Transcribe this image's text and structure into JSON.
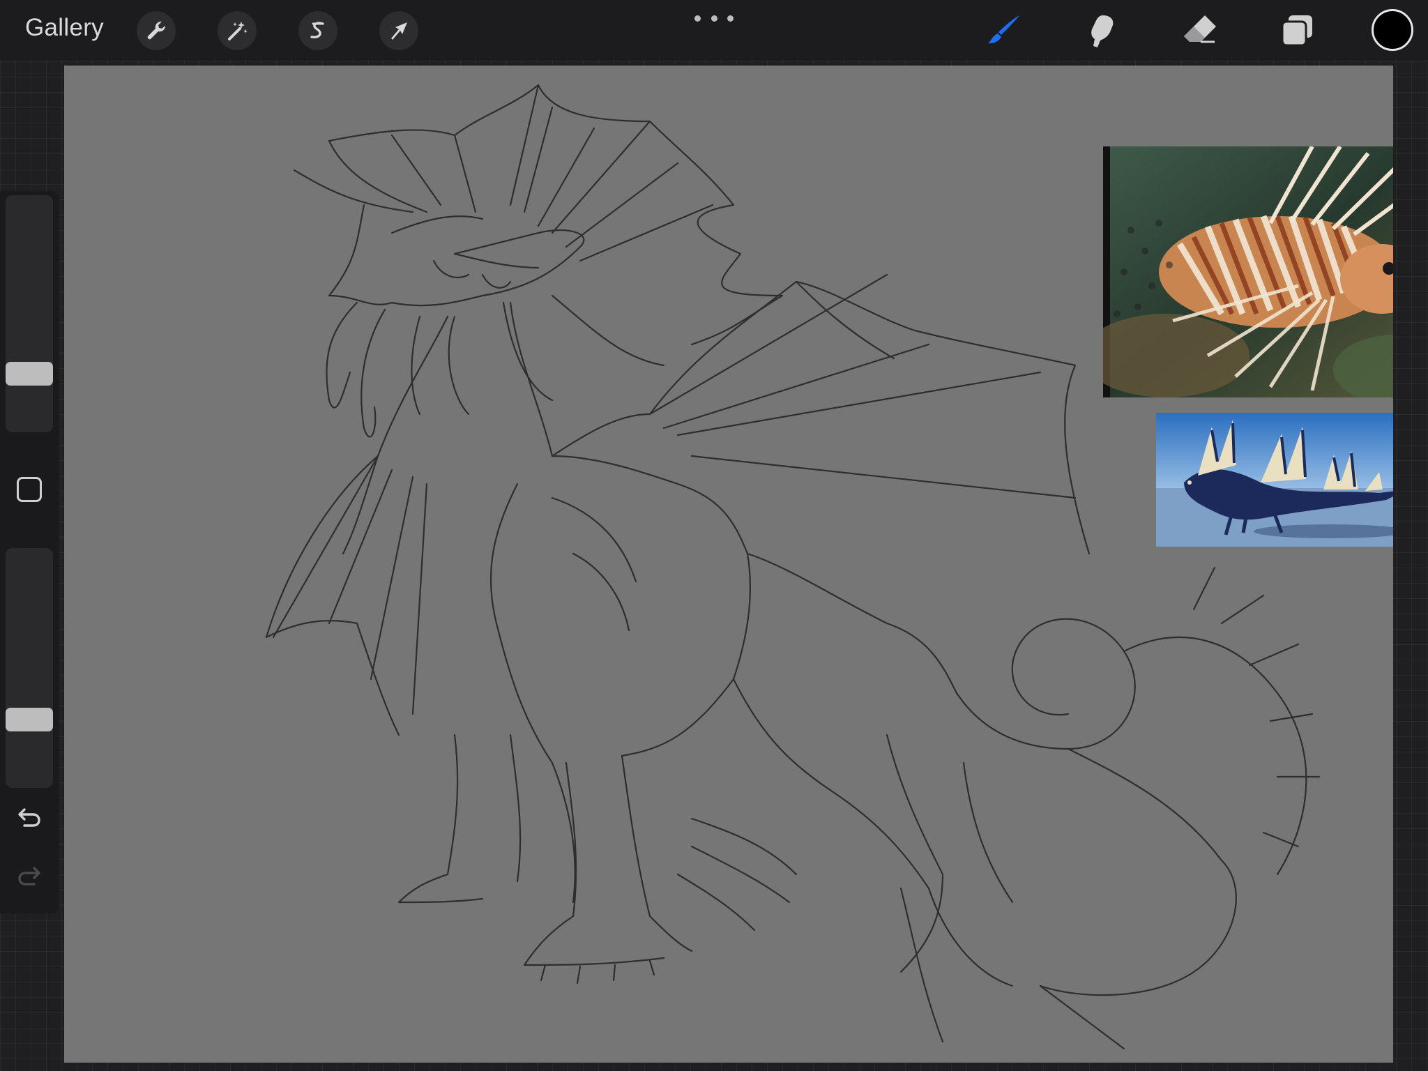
{
  "app": {
    "gallery_label": "Gallery"
  },
  "toolbar_left": [
    {
      "name": "actions",
      "icon": "wrench-icon"
    },
    {
      "name": "adjustments",
      "icon": "magic-wand-icon"
    },
    {
      "name": "selection",
      "icon": "selection-s-icon"
    },
    {
      "name": "transform",
      "icon": "arrow-cursor-icon"
    }
  ],
  "toolbar_right": [
    {
      "name": "brush",
      "icon": "brush-icon",
      "active": true
    },
    {
      "name": "smudge",
      "icon": "smudge-icon",
      "active": false
    },
    {
      "name": "eraser",
      "icon": "eraser-icon",
      "active": false
    },
    {
      "name": "layers",
      "icon": "layers-icon",
      "active": false
    }
  ],
  "current_color": "#000000",
  "accent_color": "#1e6ff2",
  "sidebar": {
    "brush_size_level": 0.22,
    "opacity_level": 0.26
  }
}
